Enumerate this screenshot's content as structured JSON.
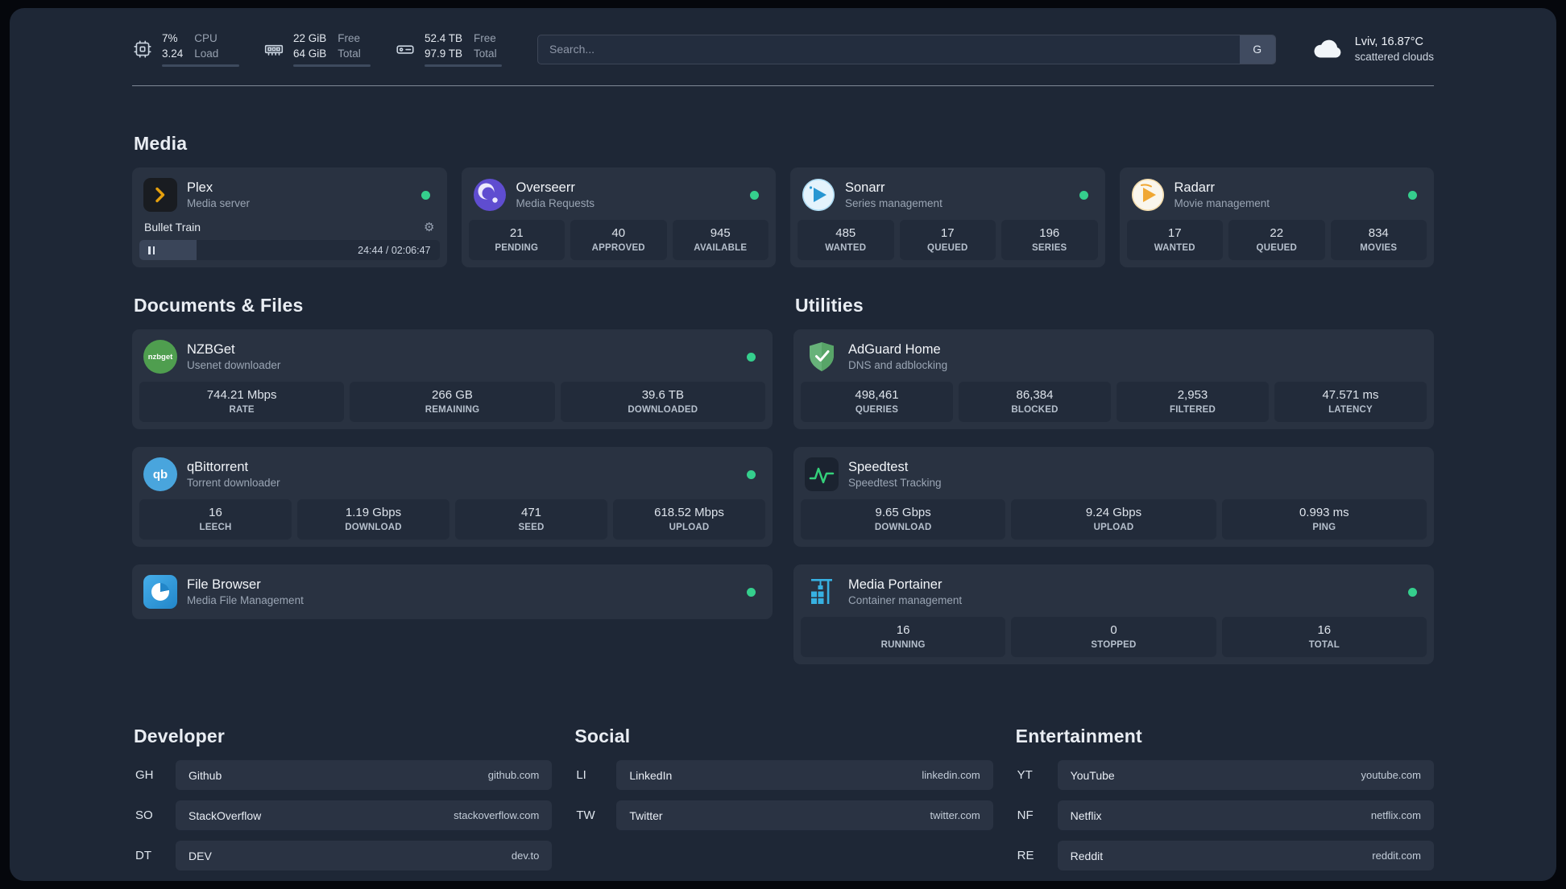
{
  "colors": {
    "background": "#1e2736",
    "card": "#293241",
    "stat_tile": "#222b3a",
    "status_online": "#35cf8d",
    "plex_amber": "#e5a00d",
    "overseerr_purple": "#5f4dd0",
    "sonarr_blue": "#2796d2",
    "radarr_amber": "#f0a732",
    "nzbget_green": "#4f9e4f",
    "qbittorrent_blue": "#49a5dd",
    "filebrowser_blue": "#2286c9",
    "adguard_green": "#67b279",
    "speedtest_green": "#34d17b",
    "portainer_blue": "#37b1e2"
  },
  "topbar": {
    "resources": [
      {
        "top_value": "7%",
        "top_label": "CPU",
        "bottom_value": "3.24",
        "bottom_label": "Load",
        "progress": 12
      },
      {
        "top_value": "22 GiB",
        "top_label": "Free",
        "bottom_value": "64 GiB",
        "bottom_label": "Total",
        "progress": 64
      },
      {
        "top_value": "52.4 TB",
        "top_label": "Free",
        "bottom_value": "97.9 TB",
        "bottom_label": "Total",
        "progress": 48
      }
    ],
    "search": {
      "placeholder": "Search...",
      "provider_label": "G"
    },
    "weather": {
      "location": "Lviv, 16.87°C",
      "description": "scattered clouds"
    }
  },
  "groups": {
    "media": {
      "title": "Media",
      "services": [
        {
          "name": "Plex",
          "subtitle": "Media server",
          "online": true,
          "player": {
            "title": "Bullet Train",
            "time": "24:44 / 02:06:47",
            "progress": 19
          }
        },
        {
          "name": "Overseerr",
          "subtitle": "Media Requests",
          "online": true,
          "stats": [
            {
              "value": "21",
              "label": "PENDING"
            },
            {
              "value": "40",
              "label": "APPROVED"
            },
            {
              "value": "945",
              "label": "AVAILABLE"
            }
          ]
        },
        {
          "name": "Sonarr",
          "subtitle": "Series management",
          "online": true,
          "stats": [
            {
              "value": "485",
              "label": "WANTED"
            },
            {
              "value": "17",
              "label": "QUEUED"
            },
            {
              "value": "196",
              "label": "SERIES"
            }
          ]
        },
        {
          "name": "Radarr",
          "subtitle": "Movie management",
          "online": true,
          "stats": [
            {
              "value": "17",
              "label": "WANTED"
            },
            {
              "value": "22",
              "label": "QUEUED"
            },
            {
              "value": "834",
              "label": "MOVIES"
            }
          ]
        }
      ]
    },
    "documents": {
      "title": "Documents & Files",
      "services": [
        {
          "name": "NZBGet",
          "subtitle": "Usenet downloader",
          "online": true,
          "icon_text": "nzbget",
          "stats": [
            {
              "value": "744.21 Mbps",
              "label": "RATE"
            },
            {
              "value": "266 GB",
              "label": "REMAINING"
            },
            {
              "value": "39.6 TB",
              "label": "DOWNLOADED"
            }
          ]
        },
        {
          "name": "qBittorrent",
          "subtitle": "Torrent downloader",
          "online": true,
          "icon_text": "qb",
          "stats": [
            {
              "value": "16",
              "label": "LEECH"
            },
            {
              "value": "1.19 Gbps",
              "label": "DOWNLOAD"
            },
            {
              "value": "471",
              "label": "SEED"
            },
            {
              "value": "618.52 Mbps",
              "label": "UPLOAD"
            }
          ]
        },
        {
          "name": "File Browser",
          "subtitle": "Media File Management",
          "online": true
        }
      ]
    },
    "utilities": {
      "title": "Utilities",
      "services": [
        {
          "name": "AdGuard Home",
          "subtitle": "DNS and adblocking",
          "online": false,
          "stats": [
            {
              "value": "498,461",
              "label": "QUERIES"
            },
            {
              "value": "86,384",
              "label": "BLOCKED"
            },
            {
              "value": "2,953",
              "label": "FILTERED"
            },
            {
              "value": "47.571 ms",
              "label": "LATENCY"
            }
          ]
        },
        {
          "name": "Speedtest",
          "subtitle": "Speedtest Tracking",
          "online": false,
          "stats": [
            {
              "value": "9.65 Gbps",
              "label": "DOWNLOAD"
            },
            {
              "value": "9.24 Gbps",
              "label": "UPLOAD"
            },
            {
              "value": "0.993 ms",
              "label": "PING"
            }
          ]
        },
        {
          "name": "Media Portainer",
          "subtitle": "Container management",
          "online": true,
          "stats": [
            {
              "value": "16",
              "label": "RUNNING"
            },
            {
              "value": "0",
              "label": "STOPPED"
            },
            {
              "value": "16",
              "label": "TOTAL"
            }
          ]
        }
      ]
    }
  },
  "bookmarks": {
    "developer": {
      "title": "Developer",
      "links": [
        {
          "abbr": "GH",
          "name": "Github",
          "url": "github.com"
        },
        {
          "abbr": "SO",
          "name": "StackOverflow",
          "url": "stackoverflow.com"
        },
        {
          "abbr": "DT",
          "name": "DEV",
          "url": "dev.to"
        }
      ]
    },
    "social": {
      "title": "Social",
      "links": [
        {
          "abbr": "LI",
          "name": "LinkedIn",
          "url": "linkedin.com"
        },
        {
          "abbr": "TW",
          "name": "Twitter",
          "url": "twitter.com"
        }
      ]
    },
    "entertainment": {
      "title": "Entertainment",
      "links": [
        {
          "abbr": "YT",
          "name": "YouTube",
          "url": "youtube.com"
        },
        {
          "abbr": "NF",
          "name": "Netflix",
          "url": "netflix.com"
        },
        {
          "abbr": "RE",
          "name": "Reddit",
          "url": "reddit.com"
        }
      ]
    }
  }
}
